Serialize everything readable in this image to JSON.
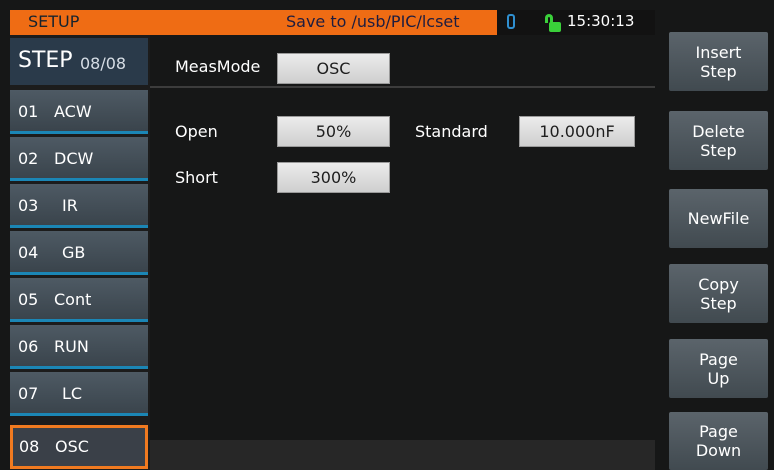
{
  "header": {
    "title": "SETUP",
    "save_path": "Save to /usb/PIC/lcset",
    "time": "15:30:13"
  },
  "step": {
    "label": "STEP",
    "current": "08/08"
  },
  "steps": [
    {
      "no": "01",
      "name": "ACW"
    },
    {
      "no": "02",
      "name": "DCW"
    },
    {
      "no": "03",
      "name": "IR"
    },
    {
      "no": "04",
      "name": "GB"
    },
    {
      "no": "05",
      "name": "Cont"
    },
    {
      "no": "06",
      "name": "RUN"
    },
    {
      "no": "07",
      "name": "LC"
    },
    {
      "no": "08",
      "name": "OSC"
    }
  ],
  "settings": {
    "meas_mode_label": "MeasMode",
    "meas_mode_value": "OSC",
    "open_label": "Open",
    "open_value": "50%",
    "standard_label": "Standard",
    "standard_value": "10.000nF",
    "short_label": "Short",
    "short_value": "300%"
  },
  "side_buttons": [
    {
      "line1": "Insert",
      "line2": "Step"
    },
    {
      "line1": "Delete",
      "line2": "Step"
    },
    {
      "line1": "NewFile",
      "line2": ""
    },
    {
      "line1": "Copy",
      "line2": "Step"
    },
    {
      "line1": "Page",
      "line2": "Up"
    },
    {
      "line1": "Page",
      "line2": "Down"
    }
  ],
  "colors": {
    "accent": "#ef6c14",
    "active_border": "#f07a20",
    "step_divider": "#1b86b5",
    "lock": "#3ad03a",
    "usb": "#2f8fd0"
  },
  "icons": {
    "usb": "usb-icon",
    "lock": "unlock-icon"
  }
}
